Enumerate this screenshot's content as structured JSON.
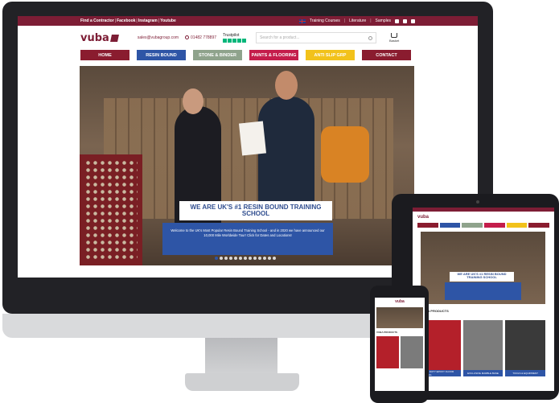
{
  "desktop": {
    "topbar": {
      "left_links": [
        "Find a Contractor",
        "Facebook",
        "Instagram",
        "Youtube"
      ],
      "right_links": [
        "Training Courses",
        "Literature",
        "Samples"
      ]
    },
    "header": {
      "logo": "vuba",
      "email": "sales@vubagroup.com",
      "phone": "01482 778897",
      "trustpilot": "Trustpilot",
      "search_placeholder": "Search for a product...",
      "basket_label": "Basket"
    },
    "nav": [
      {
        "label": "HOME",
        "color": "#8a1c2f"
      },
      {
        "label": "RESIN BOUND",
        "color": "#2e55a6"
      },
      {
        "label": "STONE & BINDER",
        "color": "#8fa38c"
      },
      {
        "label": "PAINTS & FLOORING",
        "color": "#c41d4b"
      },
      {
        "label": "ANTI SLIP GRP",
        "color": "#f2c21b"
      },
      {
        "label": "CONTACT",
        "color": "#8a1c2f"
      }
    ],
    "hero": {
      "title": "WE ARE UK'S #1 RESIN BOUND TRAINING SCHOOL",
      "body": "Welcome to the UK's Most Popular Resin Bound Training School - and in 2020 we have announced our 10,000 Mile Worldwide Tour! Click for Dates and Locations!",
      "slide_count": 13,
      "active_slide": 1
    }
  },
  "tablet": {
    "hero_title": "WE ARE UK'S #1 RESIN BOUND TRAINING SCHOOL",
    "section_title": "VUBA PRODUCTS",
    "cards": [
      {
        "label": "HEAVY DUTY EPOXY FLOOR COATING",
        "color": "#b4202a"
      },
      {
        "label": "EXCLUSIVE MARBLE BASE",
        "color": "#7b7b7b"
      },
      {
        "label": "TOOLS & EQUIPMENT",
        "color": "#3a3a3a"
      }
    ]
  },
  "phone": {
    "logo": "vuba",
    "section_title": "VUBA PRODUCTS"
  },
  "colors": {
    "brand": "#7d1d35",
    "blue": "#2e55a6"
  }
}
